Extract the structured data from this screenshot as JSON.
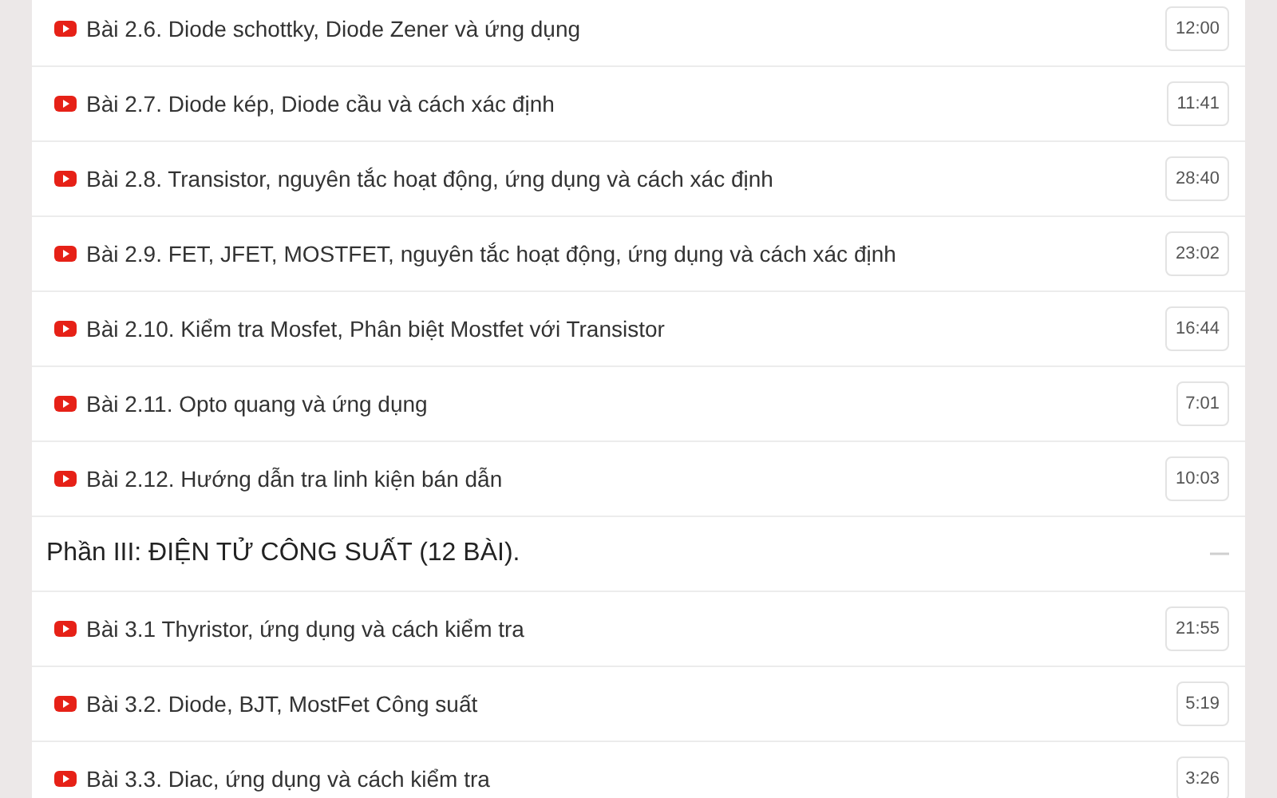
{
  "rows": [
    {
      "kind": "lesson",
      "title": "Bài 2.6. Diode schottky, Diode Zener và ứng dụng",
      "duration": "12:00"
    },
    {
      "kind": "lesson",
      "title": "Bài 2.7. Diode kép, Diode cầu và cách xác định",
      "duration": "11:41"
    },
    {
      "kind": "lesson",
      "title": "Bài 2.8. Transistor, nguyên tắc hoạt động, ứng dụng và cách xác định",
      "duration": "28:40"
    },
    {
      "kind": "lesson",
      "title": "Bài 2.9. FET, JFET, MOSTFET, nguyên tắc hoạt động, ứng dụng và cách xác định",
      "duration": "23:02"
    },
    {
      "kind": "lesson",
      "title": "Bài 2.10. Kiểm tra Mosfet, Phân biệt Mostfet với Transistor",
      "duration": "16:44"
    },
    {
      "kind": "lesson",
      "title": "Bài 2.11. Opto quang và ứng dụng",
      "duration": "7:01"
    },
    {
      "kind": "lesson",
      "title": "Bài 2.12. Hướng dẫn tra linh kiện bán dẫn",
      "duration": "10:03"
    },
    {
      "kind": "section",
      "title": "Phần III: ĐIỆN TỬ CÔNG SUẤT (12 BÀI).",
      "expanded": true
    },
    {
      "kind": "lesson",
      "title": "Bài 3.1 Thyristor, ứng dụng và cách kiểm tra",
      "duration": "21:55"
    },
    {
      "kind": "lesson",
      "title": "Bài 3.2. Diode, BJT, MostFet Công suất",
      "duration": "5:19"
    },
    {
      "kind": "lesson",
      "title": "Bài 3.3. Diac, ứng dụng và cách kiểm tra",
      "duration": "3:26"
    }
  ]
}
